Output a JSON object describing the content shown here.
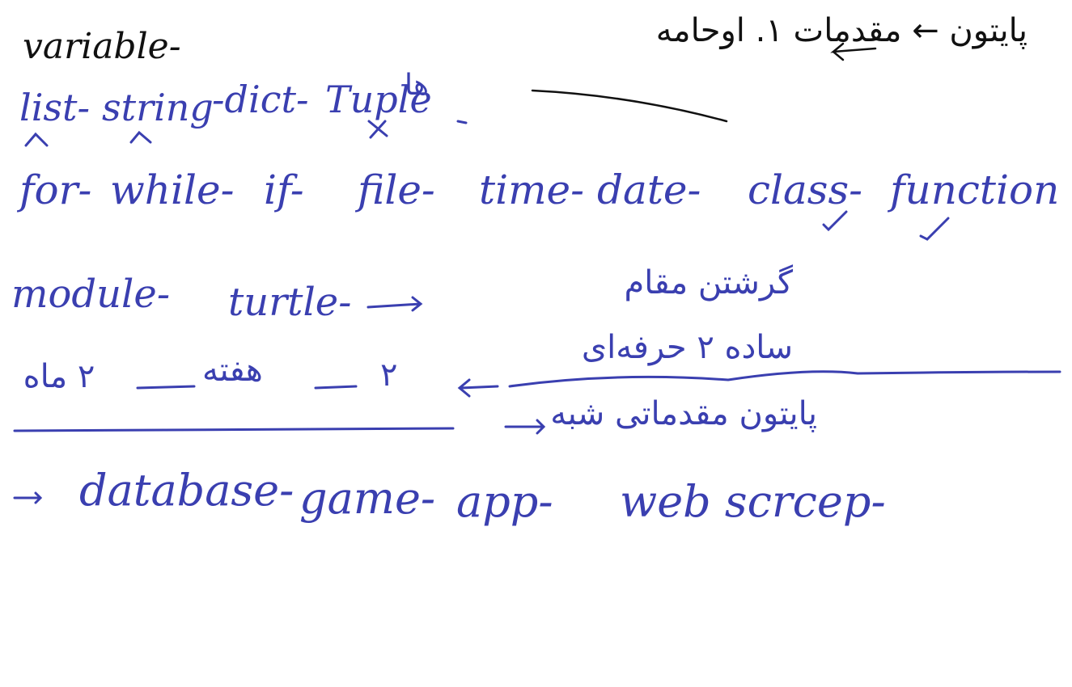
{
  "colors": {
    "black_ink": "#111111",
    "blue_ink": "#3a3fb0",
    "background": "#ffffff"
  },
  "notes": {
    "title": "variable-",
    "title_persian": "پایتون ← مقدمات ۱. اوحامه",
    "row_types": [
      "list-",
      "string",
      "-dict-",
      "Tuple"
    ],
    "row_types_ar": "ها",
    "row_control": [
      "for-",
      "while-",
      "if-",
      "file-",
      "time-",
      "date-",
      "class-",
      "function"
    ],
    "row_module": [
      "module-",
      "turtle-"
    ],
    "persian_1": "گرشتن مقام",
    "persian_2": "ساده ۲ حرفه‌ای",
    "persian_3": "پایتون مقدماتی شبه",
    "months_number": "۲",
    "months_word": "۲ ماه",
    "weeks_word": "هفته",
    "row_projects": [
      "database-",
      "game-",
      "app-",
      "web scrcep-"
    ]
  }
}
